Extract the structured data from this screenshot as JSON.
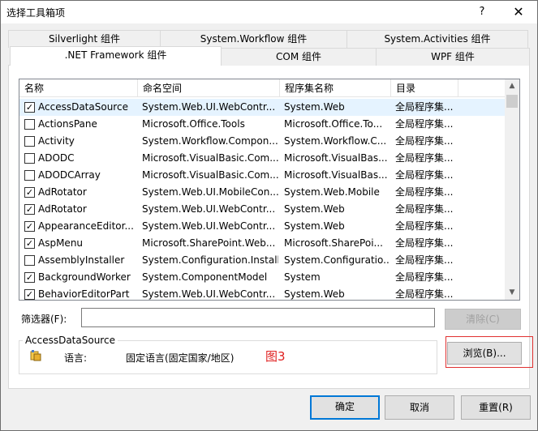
{
  "window": {
    "title": "选择工具箱项",
    "help": "?",
    "close": "✕"
  },
  "tabs_row1": [
    "Silverlight 组件",
    "System.Workflow 组件",
    "System.Activities 组件"
  ],
  "tabs_row2": [
    ".NET Framework 组件",
    "COM 组件",
    "WPF 组件"
  ],
  "active_tab": ".NET Framework 组件",
  "list": {
    "columns": [
      "名称",
      "命名空间",
      "程序集名称",
      "目录"
    ],
    "rows": [
      {
        "checked": true,
        "name": "AccessDataSource",
        "ns": "System.Web.UI.WebContr...",
        "asm": "System.Web",
        "dir": "全局程序集..."
      },
      {
        "checked": false,
        "name": "ActionsPane",
        "ns": "Microsoft.Office.Tools",
        "asm": "Microsoft.Office.To...",
        "dir": "全局程序集..."
      },
      {
        "checked": false,
        "name": "Activity",
        "ns": "System.Workflow.Compon...",
        "asm": "System.Workflow.C...",
        "dir": "全局程序集..."
      },
      {
        "checked": false,
        "name": "ADODC",
        "ns": "Microsoft.VisualBasic.Com...",
        "asm": "Microsoft.VisualBas...",
        "dir": "全局程序集..."
      },
      {
        "checked": false,
        "name": "ADODCArray",
        "ns": "Microsoft.VisualBasic.Com...",
        "asm": "Microsoft.VisualBas...",
        "dir": "全局程序集..."
      },
      {
        "checked": true,
        "name": "AdRotator",
        "ns": "System.Web.UI.MobileCon...",
        "asm": "System.Web.Mobile",
        "dir": "全局程序集..."
      },
      {
        "checked": true,
        "name": "AdRotator",
        "ns": "System.Web.UI.WebContr...",
        "asm": "System.Web",
        "dir": "全局程序集..."
      },
      {
        "checked": true,
        "name": "AppearanceEditor...",
        "ns": "System.Web.UI.WebContr...",
        "asm": "System.Web",
        "dir": "全局程序集..."
      },
      {
        "checked": true,
        "name": "AspMenu",
        "ns": "Microsoft.SharePoint.Web...",
        "asm": "Microsoft.SharePoi...",
        "dir": "全局程序集..."
      },
      {
        "checked": false,
        "name": "AssemblyInstaller",
        "ns": "System.Configuration.Install",
        "asm": "System.Configuratio...",
        "dir": "全局程序集..."
      },
      {
        "checked": true,
        "name": "BackgroundWorker",
        "ns": "System.ComponentModel",
        "asm": "System",
        "dir": "全局程序集..."
      },
      {
        "checked": true,
        "name": "BehaviorEditorPart",
        "ns": "System.Web.UI.WebContr...",
        "asm": "System.Web",
        "dir": "全局程序集..."
      }
    ]
  },
  "filter": {
    "label": "筛选器(F):",
    "value": "",
    "clear": "清除(C)"
  },
  "details": {
    "group_title": "AccessDataSource",
    "language_label": "语言:",
    "language_value": "固定语言(固定国家/地区)",
    "annotation": "图3",
    "browse": "浏览(B)..."
  },
  "buttons": {
    "ok": "确定",
    "cancel": "取消",
    "reset": "重置(R)"
  },
  "colors": {
    "selected_row": "#e5f3ff",
    "default_button_border": "#0078d7",
    "annotation": "#e02020"
  }
}
